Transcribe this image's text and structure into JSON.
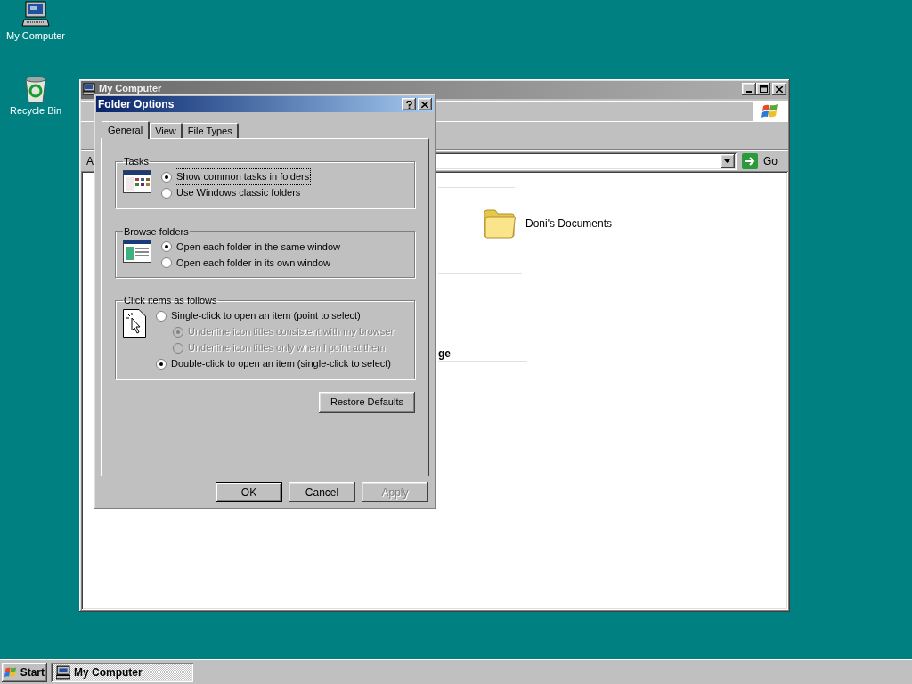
{
  "desktop": {
    "icons": [
      {
        "label": "My Computer",
        "kind": "computer"
      },
      {
        "label": "Recycle Bin",
        "kind": "recycle"
      }
    ]
  },
  "explorer": {
    "title": "My Computer",
    "active": false,
    "address_label": "A",
    "go_button": "Go",
    "section_heading": "ge",
    "items": [
      {
        "label": "Doni's Documents",
        "kind": "folder"
      }
    ]
  },
  "dialog": {
    "title": "Folder Options",
    "tabs": [
      {
        "label": "General",
        "selected": true
      },
      {
        "label": "View",
        "selected": false
      },
      {
        "label": "File Types",
        "selected": false
      }
    ],
    "groups": [
      {
        "title": "Tasks",
        "kind": "tasks",
        "options": [
          {
            "label": "Show common tasks in folders",
            "selected": true,
            "focused": true,
            "disabled": false
          },
          {
            "label": "Use Windows classic folders",
            "selected": false,
            "focused": false,
            "disabled": false
          }
        ]
      },
      {
        "title": "Browse folders",
        "kind": "browse",
        "options": [
          {
            "label": "Open each folder in the same window",
            "selected": true,
            "focused": false,
            "disabled": false
          },
          {
            "label": "Open each folder in its own window",
            "selected": false,
            "focused": false,
            "disabled": false
          }
        ]
      },
      {
        "title": "Click items as follows",
        "kind": "click",
        "options": [
          {
            "label": "Single-click to open an item (point to select)",
            "selected": false,
            "focused": false,
            "disabled": false,
            "children": [
              {
                "label": "Underline icon titles consistent with my browser",
                "selected": true,
                "focused": false,
                "disabled": true
              },
              {
                "label": "Underline icon titles only when I point at them",
                "selected": false,
                "focused": false,
                "disabled": true
              }
            ]
          },
          {
            "label": "Double-click to open an item (single-click to select)",
            "selected": true,
            "focused": false,
            "disabled": false
          }
        ]
      }
    ],
    "restore_button": "Restore Defaults",
    "buttons": [
      {
        "label": "OK",
        "default": true,
        "disabled": false
      },
      {
        "label": "Cancel",
        "default": false,
        "disabled": false
      },
      {
        "label": "Apply",
        "default": false,
        "disabled": true
      }
    ]
  },
  "taskbar": {
    "start": "Start",
    "tasks": [
      {
        "label": "My Computer",
        "pressed": true
      }
    ]
  }
}
